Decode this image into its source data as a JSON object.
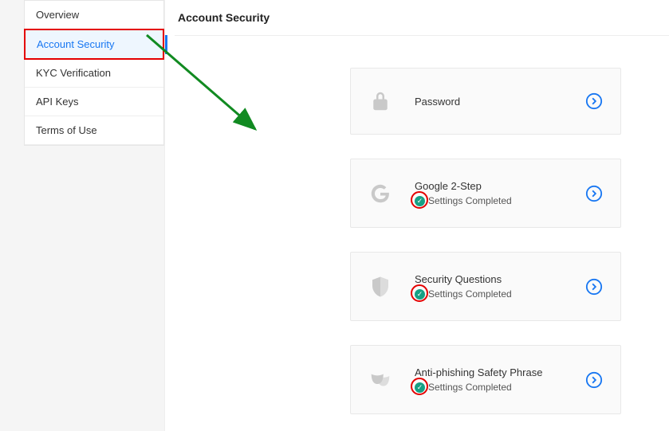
{
  "sidebar": {
    "items": [
      {
        "label": "Overview"
      },
      {
        "label": "Account Security"
      },
      {
        "label": "KYC Verification"
      },
      {
        "label": "API Keys"
      },
      {
        "label": "Terms of Use"
      }
    ],
    "active_index": 1
  },
  "page": {
    "title": "Account Security"
  },
  "cards": [
    {
      "title": "Password",
      "status": null,
      "icon": "lock"
    },
    {
      "title": "Google 2-Step",
      "status": "Settings Completed",
      "icon": "google"
    },
    {
      "title": "Security Questions",
      "status": "Settings Completed",
      "icon": "shield"
    },
    {
      "title": "Anti-phishing Safety Phrase",
      "status": "Settings Completed",
      "icon": "masks"
    }
  ]
}
